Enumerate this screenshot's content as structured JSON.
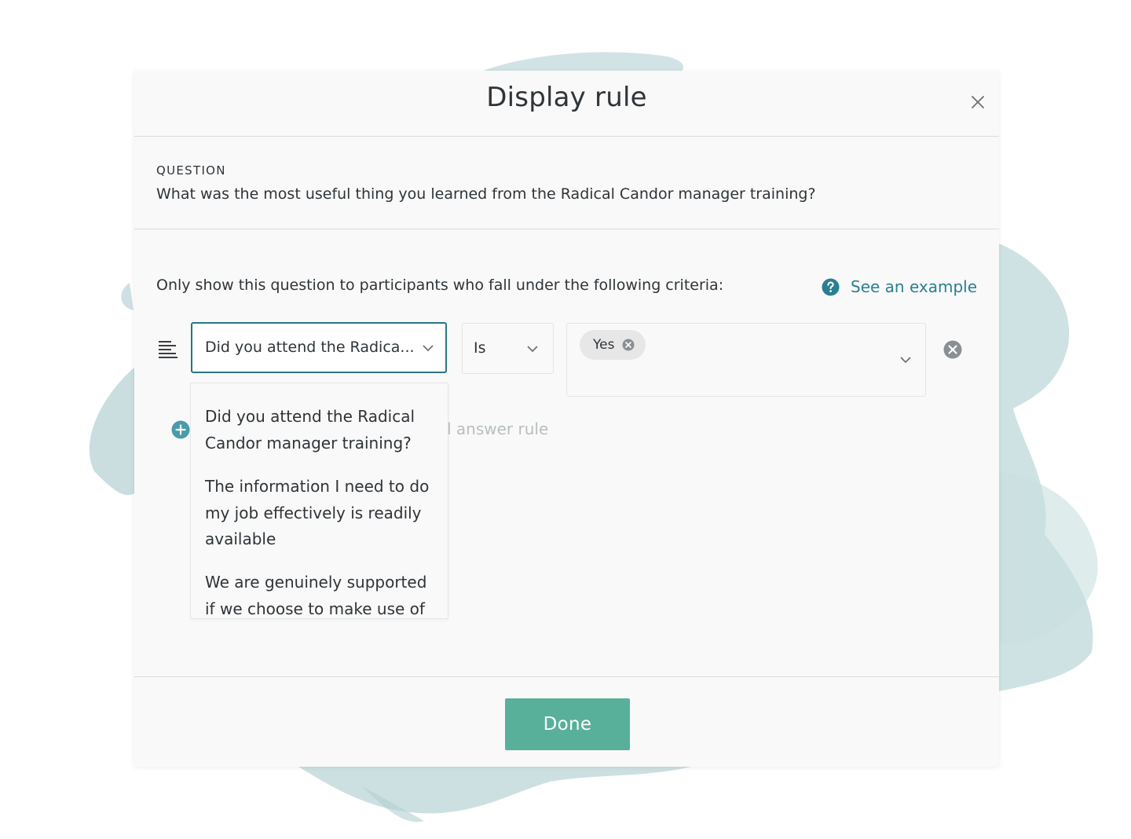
{
  "colors": {
    "accent_teal": "#2b7f92",
    "select_border": "#2b7484",
    "done_button": "#58b09a",
    "splash": "#bcd6d7"
  },
  "modal": {
    "title": "Display rule",
    "close_icon": "close-icon"
  },
  "question": {
    "label": "QUESTION",
    "text": "What was the most useful thing you learned from the Radical Candor manager training?"
  },
  "criteria": {
    "intro": "Only show this question to participants who fall under the following criteria:",
    "example_link": "See an example",
    "example_icon": "help-circle-icon"
  },
  "rule": {
    "type_icon": "text-lines-icon",
    "question_select_value": "Did you attend the Radica...",
    "operator_value": "Is",
    "value_tags": [
      "Yes"
    ],
    "remove_icon": "remove-circle-icon"
  },
  "add_rule": {
    "label_visible": "l answer rule",
    "icon": "plus-circle-icon"
  },
  "dropdown": {
    "options": [
      "Did you attend the Radical Candor manager training?",
      "The information I need to do my job effectively is readily available",
      "We are genuinely supported if we choose to make use of"
    ]
  },
  "footer": {
    "done_label": "Done"
  }
}
